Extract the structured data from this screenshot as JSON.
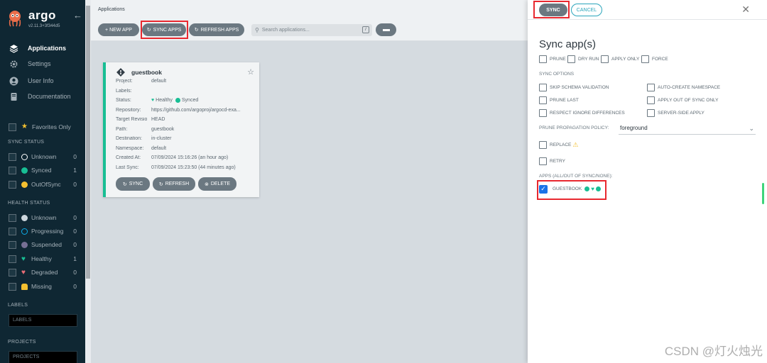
{
  "sidebar": {
    "logo": "argo",
    "version": "v2.11.3+3f344d5",
    "nav": [
      {
        "label": "Applications",
        "icon": "layers-icon",
        "active": true
      },
      {
        "label": "Settings",
        "icon": "gear-icon",
        "active": false
      },
      {
        "label": "User Info",
        "icon": "user-icon",
        "active": false
      },
      {
        "label": "Documentation",
        "icon": "book-icon",
        "active": false
      }
    ],
    "favorites_label": "Favorites Only",
    "sync_status_title": "SYNC STATUS",
    "sync_status": [
      {
        "label": "Unknown",
        "count": "0",
        "color": "#ffffff"
      },
      {
        "label": "Synced",
        "count": "1",
        "color": "#18be94"
      },
      {
        "label": "OutOfSync",
        "count": "0",
        "color": "#f4c030"
      }
    ],
    "health_status_title": "HEALTH STATUS",
    "health_status": [
      {
        "label": "Unknown",
        "count": "0",
        "color": "#ccd6dd"
      },
      {
        "label": "Progressing",
        "count": "0",
        "color": "#0dadea"
      },
      {
        "label": "Suspended",
        "count": "0",
        "color": "#766f94"
      },
      {
        "label": "Healthy",
        "count": "1",
        "color": "#18be94"
      },
      {
        "label": "Degraded",
        "count": "0",
        "color": "#e96d76"
      },
      {
        "label": "Missing",
        "count": "0",
        "color": "#f4c030"
      }
    ],
    "labels_title": "LABELS",
    "labels_placeholder": "LABELS",
    "projects_title": "PROJECTS",
    "projects_placeholder": "PROJECTS"
  },
  "main": {
    "breadcrumb": "Applications",
    "toolbar": {
      "new_app": "+ NEW APP",
      "sync_apps": "SYNC APPS",
      "refresh_apps": "REFRESH APPS",
      "search_placeholder": "Search applications...",
      "search_key": "/"
    },
    "tile": {
      "name": "guestbook",
      "rows": [
        {
          "k": "Project:",
          "v": "default"
        },
        {
          "k": "Labels:",
          "v": ""
        },
        {
          "k": "Status:",
          "v": "Healthy",
          "v2": "Synced"
        },
        {
          "k": "Repository:",
          "v": "https://github.com/argoproj/argocd-exa..."
        },
        {
          "k": "Target Revision:",
          "v": "HEAD"
        },
        {
          "k": "Path:",
          "v": "guestbook"
        },
        {
          "k": "Destination:",
          "v": "in-cluster"
        },
        {
          "k": "Namespace:",
          "v": "default"
        },
        {
          "k": "Created At:",
          "v": "07/09/2024 15:16:26  (an hour ago)"
        },
        {
          "k": "Last Sync:",
          "v": "07/09/2024 15:23:50  (44 minutes ago)"
        }
      ],
      "sync_label": "SYNC",
      "refresh_label": "REFRESH",
      "delete_label": "DELETE"
    }
  },
  "panel": {
    "sync_label": "SYNC",
    "cancel_label": "CANCEL",
    "title": "Sync app(s)",
    "top_options": [
      "PRUNE",
      "DRY RUN",
      "APPLY ONLY",
      "FORCE"
    ],
    "sync_options_title": "SYNC OPTIONS",
    "sync_options_left": [
      "SKIP SCHEMA VALIDATION",
      "PRUNE LAST",
      "RESPECT IGNORE DIFFERENCES"
    ],
    "sync_options_right": [
      "AUTO-CREATE NAMESPACE",
      "APPLY OUT OF SYNC ONLY",
      "SERVER-SIDE APPLY"
    ],
    "ppp_label": "PRUNE PROPAGATION POLICY:",
    "ppp_value": "foreground",
    "replace_label": "REPLACE",
    "retry_label": "RETRY",
    "apps_title": "APPS (ALL/OUT OF SYNC/NONE):",
    "app_name": "GUESTBOOK"
  },
  "watermark": "CSDN @灯火烛光"
}
